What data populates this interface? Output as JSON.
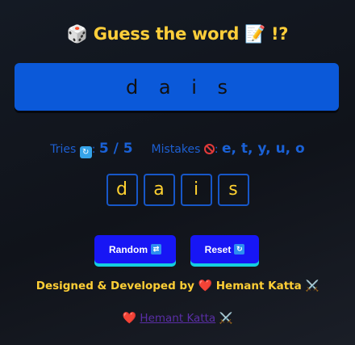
{
  "title": {
    "icon_left": "🎲",
    "text": "Guess the word",
    "icon_right": "📝",
    "suffix": "!?"
  },
  "word_display": "d a i s",
  "stats": {
    "tries_label": "Tries",
    "tries_icon": "🔃",
    "tries_sep": ":",
    "tries_value": "5 / 5",
    "mistakes_label": "Mistakes",
    "mistakes_sep": ":",
    "mistakes_value": "e, t, y, u, o"
  },
  "tiles": [
    "d",
    "a",
    "i",
    "s"
  ],
  "buttons": {
    "random_label": "Random",
    "random_icon": "🔀",
    "reset_label": "Reset",
    "reset_icon": "🔄"
  },
  "credit": {
    "text": "Designed & Developed by",
    "heart": "❤️",
    "name": "Hemant Katta",
    "sword": "⚔️"
  },
  "footer": {
    "heart": "❤️",
    "link_text": "Hemant Katta",
    "sword": "⚔️"
  },
  "colors": {
    "accent_yellow": "#ffce3a",
    "primary_blue": "#0b59d9",
    "button_blue": "#1716f5",
    "button_shadow": "#14cfe0",
    "stats_blue": "#1d5fd1",
    "link_purple": "#5a2ea6"
  },
  "icons": {
    "title_left": "dice-icon",
    "title_right": "memo-icon",
    "tries": "refresh-icon",
    "mistakes": "no-entry-icon",
    "random": "shuffle-icon",
    "reset": "reset-icon",
    "heart": "heart-icon",
    "swords": "crossed-swords-icon"
  }
}
